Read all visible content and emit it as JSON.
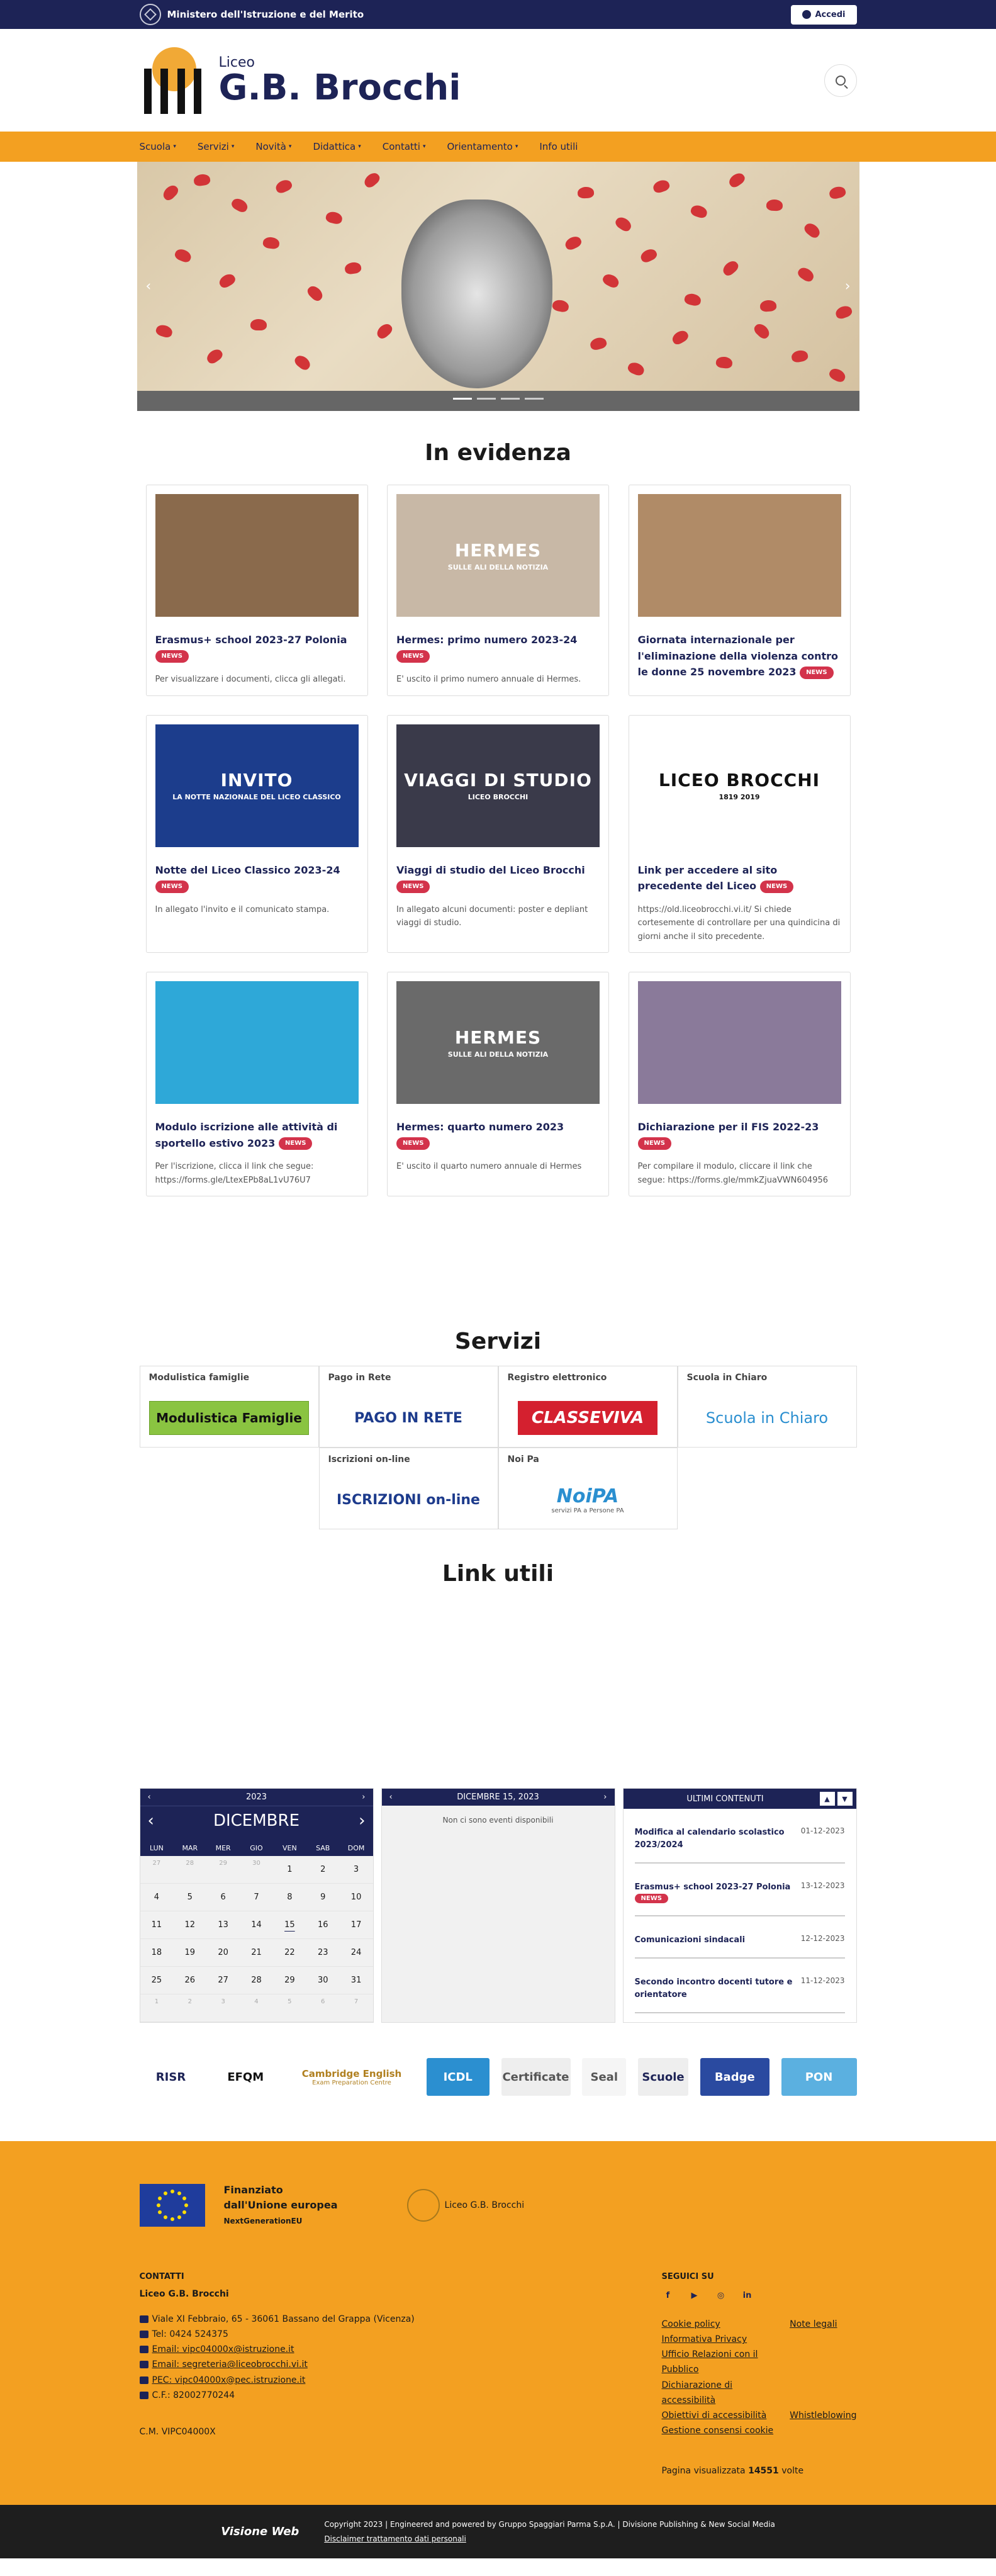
{
  "topbar": {
    "ministry": "Ministero dell'Istruzione e del Merito",
    "login": "Accedi"
  },
  "header": {
    "prefix": "Liceo",
    "name": "G.B. Brocchi"
  },
  "nav": [
    {
      "label": "Scuola",
      "dropdown": true
    },
    {
      "label": "Servizi",
      "dropdown": true
    },
    {
      "label": "Novità",
      "dropdown": true
    },
    {
      "label": "Didattica",
      "dropdown": true
    },
    {
      "label": "Contatti",
      "dropdown": true
    },
    {
      "label": "Orientamento",
      "dropdown": true
    },
    {
      "label": "Info utili",
      "dropdown": false
    }
  ],
  "evidenza": {
    "title": "In evidenza",
    "badge": "NEWS",
    "cards": [
      {
        "title": "Erasmus+ school 2023-27 Polonia",
        "text": "Per visualizzare i documenti, clicca gli allegati.",
        "img_text": "",
        "img_bg": "#8a6a4c",
        "badge": true
      },
      {
        "title": "Hermes: primo numero 2023-24",
        "text": "E' uscito il primo numero annuale di Hermes.",
        "img_text": "HERMES",
        "img_sub": "SULLE ALI DELLA NOTIZIA",
        "img_bg": "#c8b8a6",
        "badge": true
      },
      {
        "title": "Giornata internazionale per l'eliminazione della violenza contro le donne 25 novembre 2023",
        "text": "",
        "img_text": "",
        "img_bg": "#b08b67",
        "badge": true
      },
      {
        "title": "Notte del Liceo Classico 2023-24",
        "text": "In allegato l'invito e il comunicato stampa.",
        "img_text": "INVITO",
        "img_sub": "LA NOTTE NAZIONALE DEL LICEO CLASSICO",
        "img_bg": "#1c3d8c",
        "badge": true
      },
      {
        "title": "Viaggi di studio del Liceo Brocchi",
        "text": "In allegato alcuni documenti: poster e depliant viaggi di studio.",
        "img_text": "VIAGGI DI STUDIO",
        "img_sub": "LICEO BROCCHI",
        "img_bg": "#3a3a4a",
        "badge": true
      },
      {
        "title": "Link per accedere al sito precedente del Liceo",
        "text": "https://old.liceobrocchi.vi.it/ Si chiede cortesemente di controllare per una quindicina di giorni anche il sito precedente.",
        "img_text": "LICEO BROCCHI",
        "img_sub": "1819 2019",
        "img_bg": "#ffffff",
        "badge": true
      },
      {
        "title": "Modulo iscrizione alle attività di sportello estivo 2023",
        "text": "Per l'iscrizione, clicca il link che segue: https://forms.gle/LtexEPb8aL1vU76U7",
        "img_text": "",
        "img_bg": "#2ea8d8",
        "badge": true
      },
      {
        "title": "Hermes: quarto numero 2023",
        "text": "E' uscito il quarto numero annuale di Hermes",
        "img_text": "HERMES",
        "img_sub": "SULLE ALI DELLA NOTIZIA",
        "img_bg": "#6a6a6a",
        "badge": true
      },
      {
        "title": "Dichiarazione per il FIS 2022-23",
        "text": "Per compilare il modulo, cliccare il link che segue: https://forms.gle/mmkZjuaVWN604956",
        "img_text": "",
        "img_bg": "#8a7a9a",
        "badge": true
      }
    ]
  },
  "servizi": {
    "title": "Servizi",
    "items": [
      {
        "label": "Modulistica famiglie",
        "logo": "Modulistica Famiglie"
      },
      {
        "label": "Pago in Rete",
        "logo": "PAGO IN RETE"
      },
      {
        "label": "Registro elettronico",
        "logo": "CLASSEVIVA"
      },
      {
        "label": "Scuola in Chiaro",
        "logo": "Scuola in Chiaro"
      },
      {
        "label": "Iscrizioni on-line",
        "logo": "ISCRIZIONI on-line"
      },
      {
        "label": "Noi Pa",
        "logo": "NoiPA",
        "logo_sub": "servizi PA a Persone PA"
      }
    ]
  },
  "link_utili": {
    "title": "Link utili"
  },
  "calendar": {
    "year": "2023",
    "month": "DICEMBRE",
    "dow": [
      "LUN",
      "MAR",
      "MER",
      "GIO",
      "VEN",
      "SAB",
      "DOM"
    ],
    "days": [
      {
        "d": "27",
        "m": true
      },
      {
        "d": "28",
        "m": true
      },
      {
        "d": "29",
        "m": true
      },
      {
        "d": "30",
        "m": true
      },
      {
        "d": "1"
      },
      {
        "d": "2"
      },
      {
        "d": "3"
      },
      {
        "d": "4"
      },
      {
        "d": "5"
      },
      {
        "d": "6"
      },
      {
        "d": "7"
      },
      {
        "d": "8"
      },
      {
        "d": "9"
      },
      {
        "d": "10"
      },
      {
        "d": "11"
      },
      {
        "d": "12"
      },
      {
        "d": "13"
      },
      {
        "d": "14"
      },
      {
        "d": "15",
        "today": true
      },
      {
        "d": "16"
      },
      {
        "d": "17"
      },
      {
        "d": "18"
      },
      {
        "d": "19"
      },
      {
        "d": "20"
      },
      {
        "d": "21"
      },
      {
        "d": "22"
      },
      {
        "d": "23"
      },
      {
        "d": "24"
      },
      {
        "d": "25"
      },
      {
        "d": "26"
      },
      {
        "d": "27"
      },
      {
        "d": "28"
      },
      {
        "d": "29"
      },
      {
        "d": "30"
      },
      {
        "d": "31"
      },
      {
        "d": "1",
        "m": true
      },
      {
        "d": "2",
        "m": true
      },
      {
        "d": "3",
        "m": true
      },
      {
        "d": "4",
        "m": true
      },
      {
        "d": "5",
        "m": true
      },
      {
        "d": "6",
        "m": true
      },
      {
        "d": "7",
        "m": true
      }
    ]
  },
  "events": {
    "date": "DICEMBRE 15, 2023",
    "empty": "Non ci sono eventi disponibili"
  },
  "latest": {
    "title": "ULTIMI CONTENUTI",
    "items": [
      {
        "title": "Modifica al calendario scolastico 2023/2024",
        "date": "01-12-2023",
        "badge": false
      },
      {
        "title": "Erasmus+ school 2023-27 Polonia",
        "date": "13-12-2023",
        "badge": true
      },
      {
        "title": "Comunicazioni sindacali",
        "date": "12-12-2023",
        "badge": false
      },
      {
        "title": "Secondo incontro docenti tutore e orientatore",
        "date": "11-12-2023",
        "badge": false
      }
    ]
  },
  "partners": [
    {
      "name": "RISR",
      "color": "#1d2356",
      "bg": "#ffffff"
    },
    {
      "name": "EFQM",
      "color": "#111111",
      "bg": "#ffffff"
    },
    {
      "name": "Cambridge English",
      "sub": "Exam Preparation Centre",
      "color": "#b08020",
      "bg": "#ffffff"
    },
    {
      "name": "ICDL",
      "color": "#ffffff",
      "bg": "#2b8fd0"
    },
    {
      "name": "Certificate",
      "color": "#555555",
      "bg": "#eeeeee"
    },
    {
      "name": "Seal",
      "color": "#555555",
      "bg": "#f5f5f5"
    },
    {
      "name": "Scuole",
      "color": "#1d2356",
      "bg": "#eeeeee"
    },
    {
      "name": "Badge",
      "color": "#ffffff",
      "bg": "#2a4aa0"
    },
    {
      "name": "PON",
      "color": "#ffffff",
      "bg": "#5bb0e0"
    }
  ],
  "footer": {
    "fund_l1": "Finanziato",
    "fund_l2": "dall'Unione europea",
    "fund_l3": "NextGenerationEU",
    "school_mark": "Liceo G.B. Brocchi",
    "contacts_title": "CONTATTI",
    "school": "Liceo G.B. Brocchi",
    "contacts": [
      "Viale XI Febbraio, 65 - 36061 Bassano del Grappa (Vicenza)",
      "Tel: 0424 524375",
      "Email: vipc04000x@istruzione.it",
      "Email: segreteria@liceobrocchi.vi.it",
      "PEC: vipc04000x@pec.istruzione.it",
      "C.F.: 82002770244"
    ],
    "cm": "C.M. VIPC04000X",
    "follow_title": "SEGUICI SU",
    "socials": [
      "facebook-icon",
      "youtube-icon",
      "instagram-icon",
      "linkedin-icon"
    ],
    "social_glyphs": [
      "f",
      "▶",
      "◎",
      "in"
    ],
    "links": [
      [
        "Cookie policy",
        "Note legali"
      ],
      [
        "Informativa Privacy",
        ""
      ],
      [
        "Ufficio Relazioni con il Pubblico",
        ""
      ],
      [
        "Dichiarazione di accessibilità",
        ""
      ],
      [
        "Obiettivi di accessibilità",
        "Whistleblowing"
      ],
      [
        "Gestione consensi cookie",
        ""
      ]
    ],
    "counter_pre": "Pagina visualizzata",
    "counter": "14551",
    "counter_post": "volte"
  },
  "bottom": {
    "brand": "Visione Web",
    "copyright": "Copyright 2023 | Engineered and powered by Gruppo Spaggiari Parma S.p.A. | Divisione Publishing & New Social Media",
    "disclaimer": "Disclaimer trattamento dati personali"
  }
}
